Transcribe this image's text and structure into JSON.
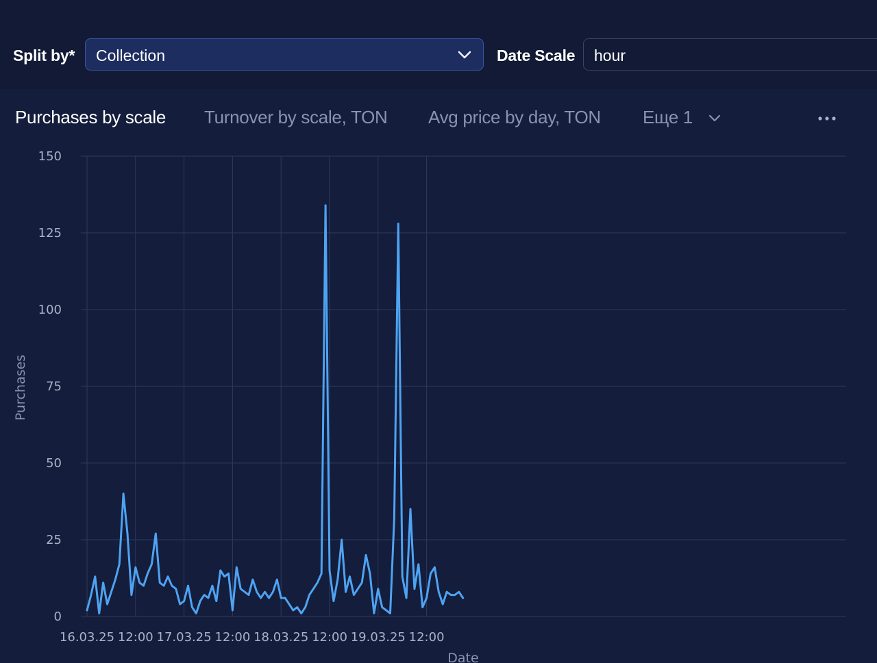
{
  "filters": {
    "split_by_label": "Split by*",
    "split_by_value": "Collection",
    "date_scale_label": "Date Scale",
    "date_scale_value": "hour"
  },
  "tabs": [
    {
      "label": "Purchases by scale",
      "active": true
    },
    {
      "label": "Turnover by scale, TON",
      "active": false
    },
    {
      "label": "Avg price by day, TON",
      "active": false
    },
    {
      "label": "Еще 1",
      "active": false
    }
  ],
  "colors": {
    "background": "#141d3b",
    "line": "#4ea3f2",
    "grid": "#2c3a5f",
    "select_bg": "#1d2d60"
  },
  "chart_data": {
    "type": "line",
    "title": "Purchases by scale",
    "xlabel": "Date",
    "ylabel": "Purchases",
    "ylim": [
      0,
      150
    ],
    "y_ticks": [
      0,
      25,
      50,
      75,
      100,
      125,
      150
    ],
    "x_start": "16.03.25 00:00",
    "x_interval": "1 hour",
    "x_ticks": [
      "16.03.25",
      "12:00",
      "17.03.25",
      "12:00",
      "18.03.25",
      "12:00",
      "19.03.25",
      "12:00"
    ],
    "grid": true,
    "series": [
      {
        "values": [
          2,
          7,
          13,
          1,
          11,
          4,
          8,
          12,
          17,
          40,
          27,
          7,
          16,
          11,
          10,
          14,
          17,
          27,
          11,
          10,
          13,
          10,
          9,
          4,
          5,
          10,
          3,
          1,
          5,
          7,
          6,
          10,
          5,
          15,
          13,
          14,
          2,
          16,
          9,
          8,
          7,
          12,
          8,
          6,
          8,
          6,
          8,
          12,
          6,
          6,
          4,
          2,
          3,
          1,
          3,
          7,
          9,
          11,
          14,
          134,
          15,
          5,
          12,
          25,
          8,
          13,
          7,
          9,
          11,
          20,
          14,
          1,
          9,
          3,
          2,
          1,
          32,
          128,
          13,
          6,
          35,
          9,
          17,
          3,
          6,
          14,
          16,
          8,
          4,
          8,
          7,
          7,
          8,
          6
        ]
      }
    ]
  }
}
